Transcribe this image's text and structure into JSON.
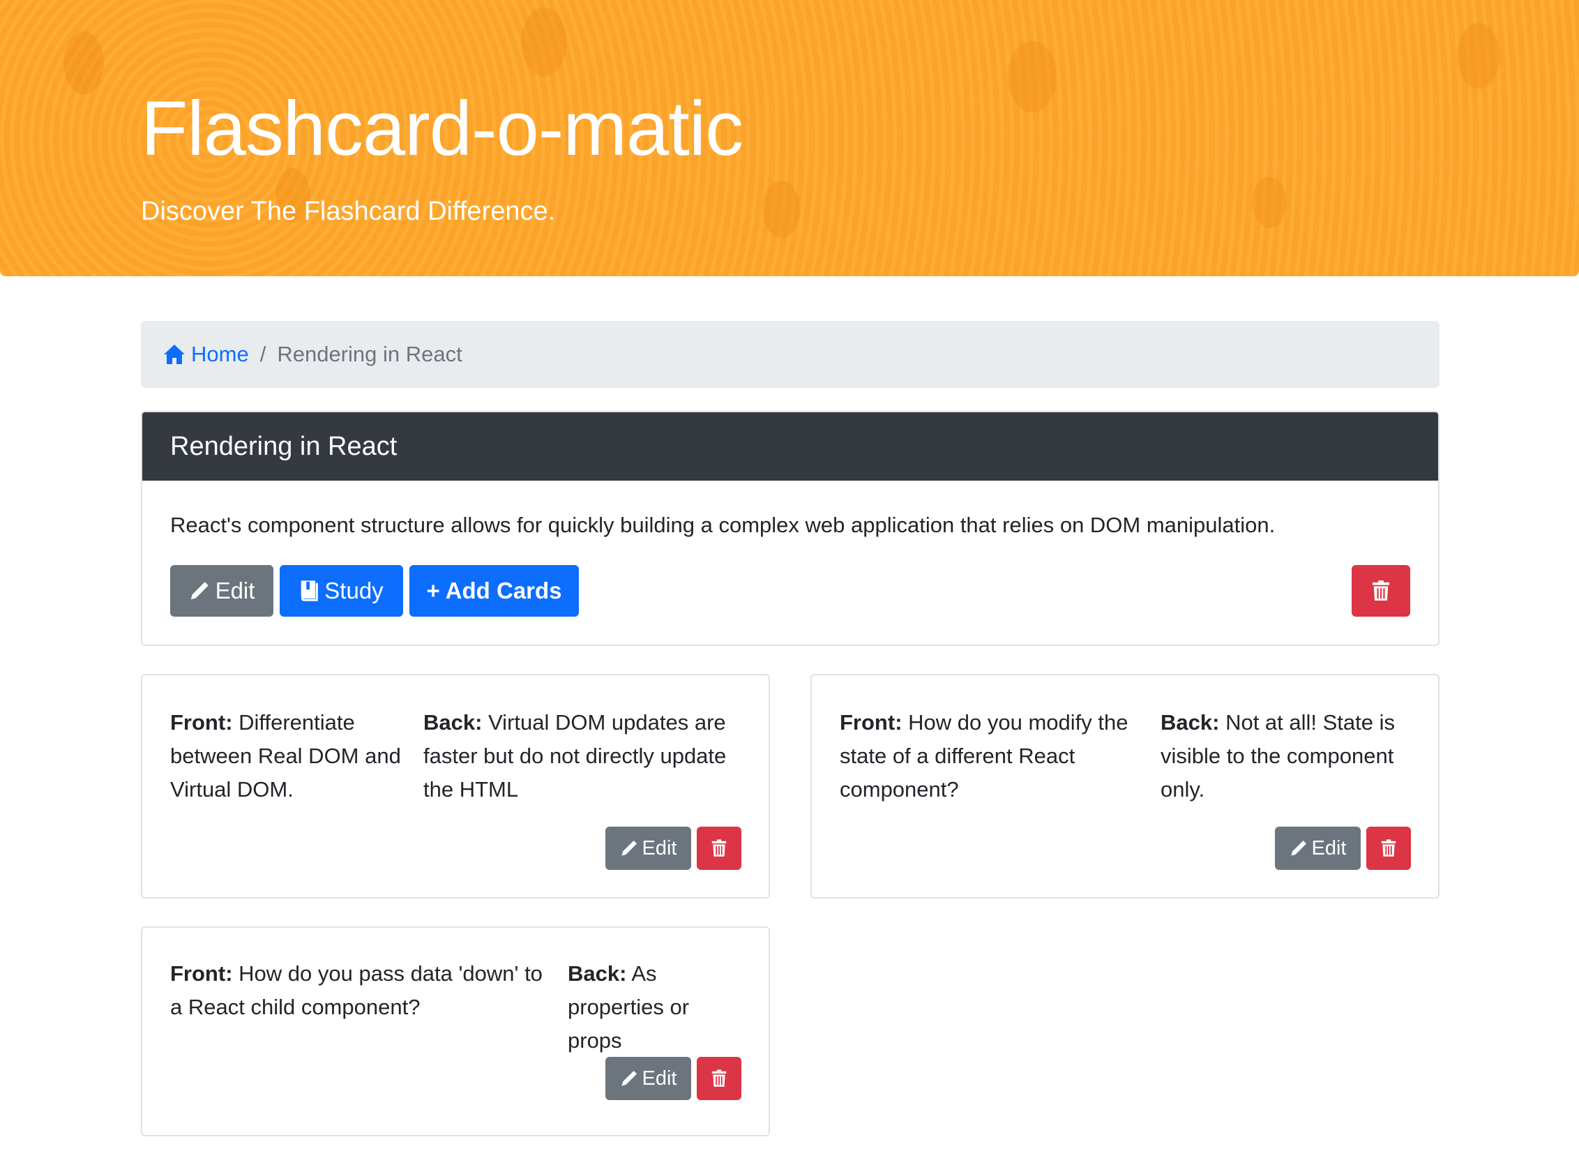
{
  "header": {
    "title": "Flashcard-o-matic",
    "subtitle": "Discover The Flashcard Difference."
  },
  "breadcrumb": {
    "home_label": "Home",
    "separator": "/",
    "current": "Rendering in React"
  },
  "deck": {
    "name": "Rendering in React",
    "description": "React's component structure allows for quickly building a complex web application that relies on DOM manipulation.",
    "edit_label": "Edit",
    "study_label": "Study",
    "add_cards_label": "+ Add Cards"
  },
  "cards": [
    {
      "front_label": "Front:",
      "front": "Differentiate between Real DOM and Virtual DOM.",
      "back_label": "Back:",
      "back": "Virtual DOM updates are faster but do not directly update the HTML",
      "edit_label": "Edit"
    },
    {
      "front_label": "Front:",
      "front": "How do you modify the state of a different React component?",
      "back_label": "Back:",
      "back": "Not at all! State is visible to the component only.",
      "edit_label": "Edit"
    },
    {
      "front_label": "Front:",
      "front": "How do you pass data 'down' to a React child component?",
      "back_label": "Back:",
      "back": "As properties or props",
      "edit_label": "Edit"
    }
  ],
  "colors": {
    "hero": "#fca62c",
    "primary": "#0d6efd",
    "secondary": "#6c757d",
    "danger": "#dc3545",
    "dark": "#343a40"
  },
  "icons": {
    "home": "house-icon",
    "edit": "pencil-icon",
    "study": "book-icon",
    "delete": "trash-icon"
  }
}
